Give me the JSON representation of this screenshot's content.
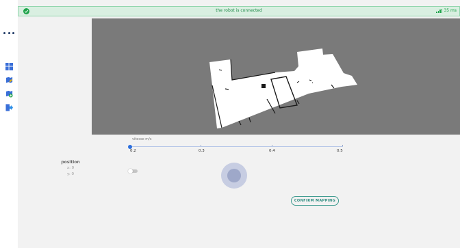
{
  "banner": {
    "status_text": "the robot is connected",
    "latency": "35 ms",
    "status_icon": "check-circle-icon",
    "signal_icon": "signal-bars-icon",
    "color_bg": "#d9efe1",
    "color_text": "#1f8a48"
  },
  "sidebar": {
    "menu_icon": "more-horizontal-icon",
    "items": [
      {
        "icon": "dashboard-icon"
      },
      {
        "icon": "map-edit-icon"
      },
      {
        "icon": "map-add-icon"
      },
      {
        "icon": "logout-icon"
      }
    ]
  },
  "map": {
    "background": "#7a7a7a"
  },
  "speed_slider": {
    "label": "vitesse m/s",
    "ticks": [
      "0.2",
      "0.3",
      "0.4",
      "0.5"
    ],
    "value": 0.2,
    "accent": "#2c6fde"
  },
  "position": {
    "title": "position",
    "x": "x: 0",
    "y": "y: 0"
  },
  "toggle": {
    "on": false
  },
  "actions": {
    "confirm_label": "CONFIRM MAPPING",
    "color": "#2a8a7e"
  }
}
